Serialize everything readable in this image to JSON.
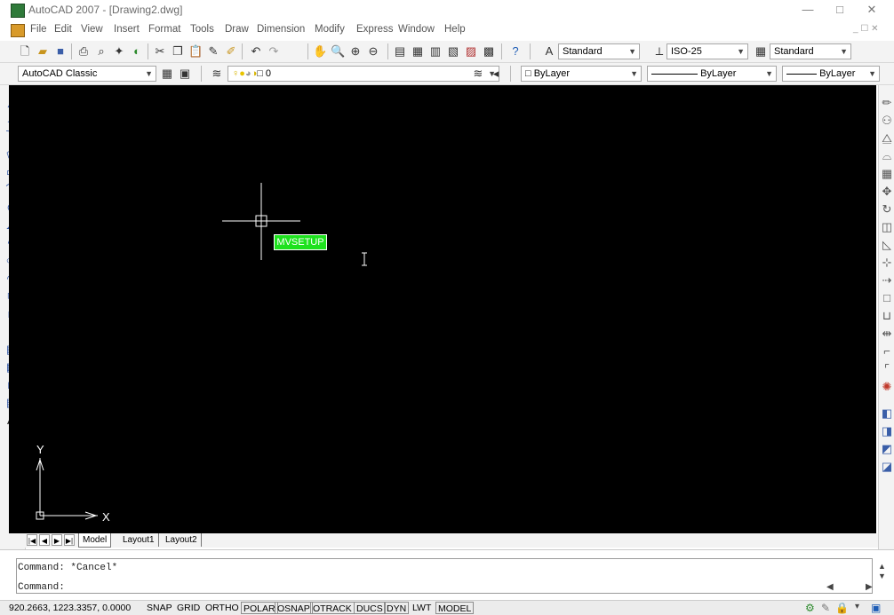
{
  "window": {
    "title": "AutoCAD 2007 - [Drawing2.dwg]",
    "min": "—",
    "max": "□",
    "close": "✕"
  },
  "menu": {
    "items": [
      "File",
      "Edit",
      "View",
      "Insert",
      "Format",
      "Tools",
      "Draw",
      "Dimension",
      "Modify",
      "Express",
      "Window",
      "Help"
    ],
    "mdi": "_ ☐ ✕"
  },
  "toolbar1": {
    "text_style": "Standard",
    "dim_style": "ISO-25",
    "table_style": "Standard"
  },
  "toolbar2": {
    "workspace": "AutoCAD Classic",
    "layer": "0",
    "color": "ByLayer",
    "linetype": "ByLayer",
    "lineweight": "ByLayer"
  },
  "canvas": {
    "tooltip": "MVSETUP",
    "ucs_y": "Y",
    "ucs_x": "X"
  },
  "tabs": {
    "model": "Model",
    "layout1": "Layout1",
    "layout2": "Layout2"
  },
  "command": {
    "line1": "Command: *Cancel*",
    "line2": "Command:"
  },
  "status": {
    "coords": "920.2663,  1223.3357, 0.0000",
    "buttons": [
      "SNAP",
      "GRID",
      "ORTHO",
      "POLAR",
      "OSNAP",
      "OTRACK",
      "DUCS",
      "DYN",
      "LWT",
      "MODEL"
    ]
  }
}
